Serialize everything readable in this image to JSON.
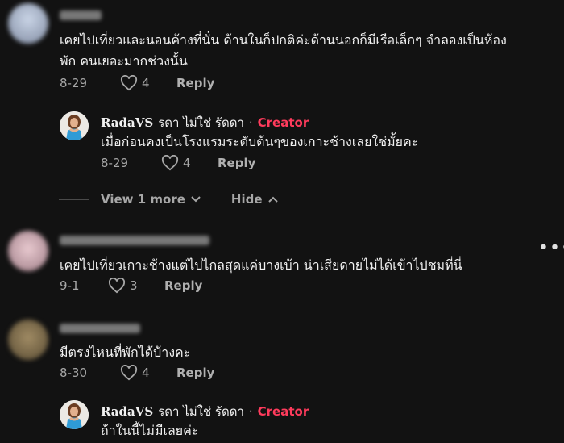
{
  "comments": [
    {
      "text": [
        "เคยไปเที่ยวและนอนค้างที่นั่น ด้านในก็ปกติค่ะด้านนอกก็มีเรือเล็กๆ จำลองเป็นห้อง",
        "พัก คนเยอะมากช่วงนั้น"
      ],
      "date": "8-29",
      "likes": "4",
      "reply_label": "Reply"
    },
    {
      "text": [
        "เคยไปเที่ยวเกาะช้างแต่ไปไกลสุดแค่บางเบ้า น่าเสียดายไม่ได้เข้าไปชมที่นี่"
      ],
      "date": "9-1",
      "likes": "3",
      "reply_label": "Reply"
    },
    {
      "text": [
        "มีตรงไหนที่พักได้บ้างคะ"
      ],
      "date": "8-30",
      "likes": "4",
      "reply_label": "Reply"
    }
  ],
  "replies": [
    {
      "username": "RadaVS",
      "display_name": "รดา ไม่ใช่ รัดดา",
      "separator": "·",
      "badge": "Creator",
      "text": "เมื่อก่อนคงเป็นโรงแรมระดับต้นๆของเกาะช้างเลยใช่มั้ยคะ",
      "date": "8-29",
      "likes": "4",
      "reply_label": "Reply"
    },
    {
      "username": "RadaVS",
      "display_name": "รดา ไม่ใช่ รัดดา",
      "separator": "·",
      "badge": "Creator",
      "text": "ถ้าในนี้ไม่มีเลยค่ะ"
    }
  ],
  "thread_controls": {
    "view_more_label": "View 1 more",
    "hide_label": "Hide"
  },
  "more_menu": "•••",
  "colors": {
    "background": "#121212",
    "creator_badge": "#ff3b5c",
    "secondary_text": "#a7a7a7"
  }
}
